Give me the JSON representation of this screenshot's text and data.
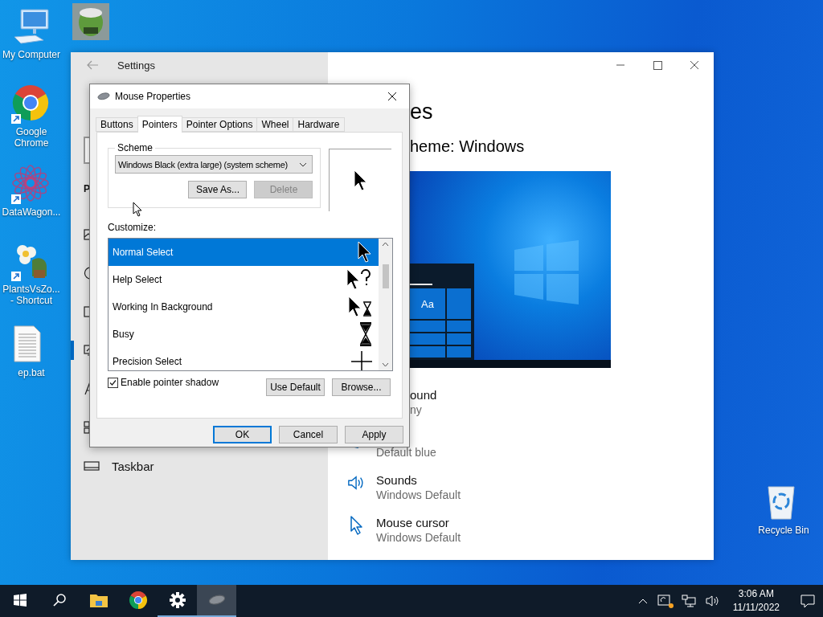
{
  "desktop_icons": [
    {
      "label": "My Computer",
      "kind": "computer",
      "shortcut": false
    },
    {
      "kind": "zombie",
      "shortcut": false
    },
    {
      "label": "Google Chrome",
      "kind": "chrome",
      "shortcut": true
    },
    {
      "label": "DataWagon...",
      "kind": "mandala",
      "shortcut": true
    },
    {
      "label": "PlantsVsZo... - Shortcut",
      "kind": "flower",
      "shortcut": true
    },
    {
      "label": "ep.bat",
      "kind": "file",
      "shortcut": false
    },
    {
      "label": "Recycle Bin",
      "kind": "recycle",
      "shortcut": false
    }
  ],
  "settings_window": {
    "title": "Settings",
    "nav_heading": "P",
    "nav_items": [
      {
        "kind": "background",
        "selected": false
      },
      {
        "kind": "colors",
        "selected": false
      },
      {
        "kind": "lockscreen",
        "selected": false
      },
      {
        "kind": "themes",
        "selected": true
      },
      {
        "kind": "fonts",
        "selected": false
      },
      {
        "kind": "start",
        "selected": false
      },
      {
        "kind": "taskbar",
        "label": "Taskbar",
        "selected": false
      }
    ],
    "heading": "es",
    "subheading": "heme: Windows",
    "preview": {
      "sample_text": "Aa"
    },
    "options": [
      {
        "kind": "clipped",
        "title": "ound",
        "value": "ny"
      },
      {
        "kind": "color",
        "value": "Default blue"
      },
      {
        "kind": "sound",
        "title": "Sounds",
        "value": "Windows Default"
      },
      {
        "kind": "cursor",
        "title": "Mouse cursor",
        "value": "Windows Default"
      }
    ]
  },
  "dialog": {
    "title": "Mouse Properties",
    "tabs": [
      {
        "label": "Buttons",
        "selected": false
      },
      {
        "label": "Pointers",
        "selected": true
      },
      {
        "label": "Pointer Options",
        "selected": false
      },
      {
        "label": "Wheel",
        "selected": false
      },
      {
        "label": "Hardware",
        "selected": false
      }
    ],
    "scheme_label": "Scheme",
    "scheme_value": "Windows Black (extra large) (system scheme)",
    "scheme_buttons": [
      {
        "label": "Save As...",
        "disabled": false
      },
      {
        "label": "Delete",
        "disabled": true
      }
    ],
    "customize_label": "Customize:",
    "pointers": [
      {
        "label": "Normal Select",
        "kind": "arrow",
        "selected": true
      },
      {
        "label": "Help Select",
        "kind": "help",
        "selected": false
      },
      {
        "label": "Working In Background",
        "kind": "working",
        "selected": false
      },
      {
        "label": "Busy",
        "kind": "busy",
        "selected": false
      },
      {
        "label": "Precision Select",
        "kind": "precision",
        "selected": false
      }
    ],
    "shadow": {
      "label": "Enable pointer shadow",
      "checked": true
    },
    "pointer_buttons": [
      "Use Default",
      "Browse..."
    ],
    "buttons": [
      {
        "label": "OK",
        "default": true
      },
      {
        "label": "Cancel",
        "default": false
      },
      {
        "label": "Apply",
        "default": false
      }
    ]
  },
  "taskbar": {
    "apps": [
      {
        "kind": "start",
        "running": false,
        "selected": false
      },
      {
        "kind": "search",
        "running": false,
        "selected": false
      },
      {
        "kind": "explorer",
        "running": false,
        "selected": false
      },
      {
        "kind": "chrome",
        "running": false,
        "selected": false
      },
      {
        "kind": "settings",
        "running": true,
        "selected": false
      },
      {
        "kind": "mouse",
        "running": true,
        "selected": true
      }
    ],
    "clock": {
      "time": "3:06 AM",
      "date": "11/11/2022"
    }
  }
}
